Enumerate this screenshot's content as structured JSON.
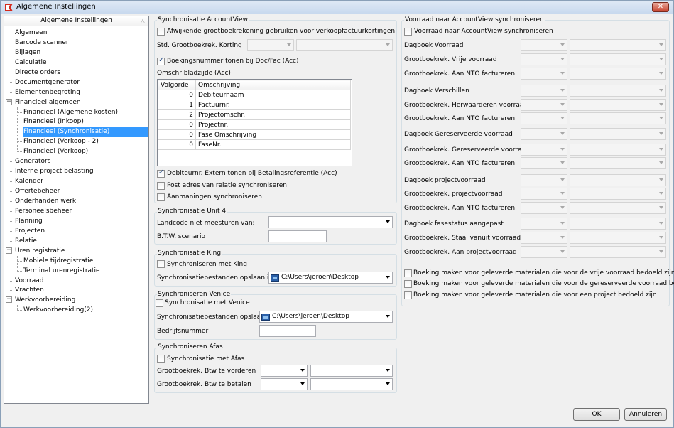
{
  "window": {
    "title": "Algemene Instellingen"
  },
  "tree": {
    "header": "Algemene Instellingen",
    "items": [
      "Algemeen",
      "Barcode scanner",
      "Bijlagen",
      "Calculatie",
      "Directe orders",
      "Documentgenerator",
      "Elementenbegroting",
      "Financieel algemeen",
      "Financieel (Algemene kosten)",
      "Financieel (Inkoop)",
      "Financieel (Synchronisatie)",
      "Financieel (Verkoop - 2)",
      "Financieel (Verkoop)",
      "Generators",
      "Interne project belasting",
      "Kalender",
      "Offertebeheer",
      "Onderhanden werk",
      "Personeelsbeheer",
      "Planning",
      "Projecten",
      "Relatie",
      "Uren registratie",
      "Mobiele tijdregistratie",
      "Terminal urenregistratie",
      "Voorraad",
      "Vrachten",
      "Werkvoorbereiding",
      "Werkvoorbereiding(2)"
    ]
  },
  "accountview": {
    "title": "Synchronisatie AccountView",
    "afwijkende_label": "Afwijkende grootboekrekening gebruiken voor verkoopfactuurkortingen",
    "korting_label": "Std. Grootboekrek. Korting",
    "boekingsnummer_label": "Boekingsnummer tonen bij Doc/Fac (Acc)",
    "omschr_label": "Omschr bladzijde (Acc)",
    "grid_headers": [
      "Volgorde",
      "Omschrijving"
    ],
    "grid_rows": [
      {
        "volgorde": "0",
        "omschrijving": "Debiteurnaam"
      },
      {
        "volgorde": "1",
        "omschrijving": "Factuurnr."
      },
      {
        "volgorde": "2",
        "omschrijving": "Projectomschr."
      },
      {
        "volgorde": "0",
        "omschrijving": "Projectnr."
      },
      {
        "volgorde": "0",
        "omschrijving": "Fase Omschrijving"
      },
      {
        "volgorde": "0",
        "omschrijving": "FaseNr."
      }
    ],
    "debiteurnr_label": "Debiteurnr. Extern tonen bij Betalingsreferentie (Acc)",
    "post_adres_label": "Post adres van relatie synchroniseren",
    "aanmaningen_label": "Aanmaningen synchroniseren"
  },
  "unit4": {
    "title": "Synchronisatie Unit 4",
    "landcode_label": "Landcode niet meesturen van:",
    "btw_label": "B.T.W. scenario"
  },
  "king": {
    "title": "Synchronisatie King",
    "sync_label": "Synchroniseren met King",
    "path_label": "Synchronisatiebestanden opslaan in:",
    "path_value": "C:\\Users\\jeroen\\Desktop"
  },
  "venice": {
    "title": "Synchroniseren Venice",
    "sync_label": "Synchronisatie met Venice",
    "path_label": "Synchronisatiebestanden opslaan in:",
    "path_value": "C:\\Users\\jeroen\\Desktop",
    "bedrijf_label": "Bedrijfsnummer"
  },
  "afas": {
    "title": "Synchroniseren Afas",
    "sync_label": "Synchronisatie met Afas",
    "vorderen_label": "Grootboekrek. Btw te vorderen",
    "betalen_label": "Grootboekrek. Btw te betalen"
  },
  "voorraad": {
    "title": "Voorraad naar AccountView synchroniseren",
    "sync_label": "Voorraad naar AccountView synchroniseren",
    "rows": [
      "Dagboek Voorraad",
      "Grootboekrek. Vrije voorraad",
      "Grootboekrek. Aan NTO factureren",
      "Dagboek Verschillen",
      "Grootboekrek. Herwaarderen voorraad",
      "Grootboekrek. Aan NTO factureren",
      "Dagboek Gereserveerde voorraad",
      "Grootboekrek. Gereserveerde voorraad",
      "Grootboekrek. Aan NTO factureren",
      "Dagboek projectvoorraad",
      "Grootboekrek. projectvoorraad",
      "Grootboekrek. Aan NTO factureren",
      "Dagboek fasestatus aangepast",
      "Grootboekrek. Staal vanuit voorraad",
      "Grootboekrek. Aan projectvoorraad"
    ],
    "boeking_checks": [
      "Boeking maken voor geleverde materialen die voor de vrije voorraad bedoeld zijn",
      "Boeking maken voor geleverde materialen die voor de gereserveerde voorraad bedoeld zijn",
      "Boeking maken voor geleverde materialen die voor een project bedoeld zijn"
    ]
  },
  "buttons": {
    "ok": "OK",
    "cancel": "Annuleren"
  }
}
